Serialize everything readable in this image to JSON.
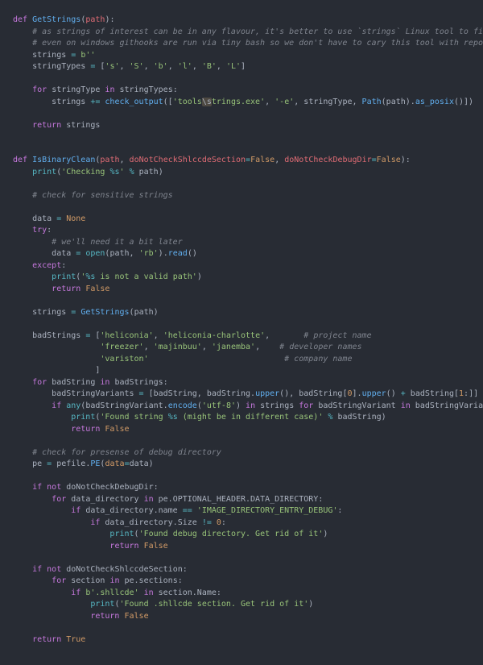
{
  "lines": [
    [
      [
        "kw",
        "def "
      ],
      [
        "fn",
        "GetStrings"
      ],
      [
        "pn",
        "("
      ],
      [
        "var",
        "path"
      ],
      [
        "pn",
        "):"
      ]
    ],
    [
      [
        "pn",
        "    "
      ],
      [
        "cmt",
        "# as strings of interest can be in any flavour, it's better to use `strings` Linux tool to find them all"
      ]
    ],
    [
      [
        "pn",
        "    "
      ],
      [
        "cmt",
        "# even on windows githooks are run via tiny bash so we don't have to cary this tool with repo"
      ]
    ],
    [
      [
        "pn",
        "    "
      ],
      [
        "id",
        "strings "
      ],
      [
        "op",
        "= "
      ],
      [
        "str",
        "b''"
      ]
    ],
    [
      [
        "pn",
        "    "
      ],
      [
        "id",
        "stringTypes "
      ],
      [
        "op",
        "= "
      ],
      [
        "pn",
        "["
      ],
      [
        "str",
        "'s'"
      ],
      [
        "pn",
        ", "
      ],
      [
        "str",
        "'S'"
      ],
      [
        "pn",
        ", "
      ],
      [
        "str",
        "'b'"
      ],
      [
        "pn",
        ", "
      ],
      [
        "str",
        "'l'"
      ],
      [
        "pn",
        ", "
      ],
      [
        "str",
        "'B'"
      ],
      [
        "pn",
        ", "
      ],
      [
        "str",
        "'L'"
      ],
      [
        "pn",
        "]"
      ]
    ],
    [
      [
        "pn",
        " "
      ]
    ],
    [
      [
        "pn",
        "    "
      ],
      [
        "kw",
        "for "
      ],
      [
        "id",
        "stringType "
      ],
      [
        "kw",
        "in "
      ],
      [
        "id",
        "stringTypes:"
      ]
    ],
    [
      [
        "pn",
        "        "
      ],
      [
        "id",
        "strings "
      ],
      [
        "op",
        "+= "
      ],
      [
        "fn",
        "check_output"
      ],
      [
        "pn",
        "(["
      ],
      [
        "str",
        "'tools"
      ],
      [
        "hl",
        "\\s"
      ],
      [
        "str",
        "trings.exe'"
      ],
      [
        "pn",
        ", "
      ],
      [
        "str",
        "'-e'"
      ],
      [
        "pn",
        ", "
      ],
      [
        "id",
        "stringType, "
      ],
      [
        "fn",
        "Path"
      ],
      [
        "pn",
        "("
      ],
      [
        "id",
        "path"
      ],
      [
        "pn",
        ")."
      ],
      [
        "fn",
        "as_posix"
      ],
      [
        "pn",
        "()])"
      ]
    ],
    [
      [
        "pn",
        " "
      ]
    ],
    [
      [
        "pn",
        "    "
      ],
      [
        "kw",
        "return "
      ],
      [
        "id",
        "strings"
      ]
    ],
    [
      [
        "pn",
        " "
      ]
    ],
    [
      [
        "pn",
        " "
      ]
    ],
    [
      [
        "kw",
        "def "
      ],
      [
        "fn",
        "IsBinaryClean"
      ],
      [
        "pn",
        "("
      ],
      [
        "var",
        "path"
      ],
      [
        "pn",
        ", "
      ],
      [
        "var",
        "doNotCheckShlccdeSection"
      ],
      [
        "op",
        "="
      ],
      [
        "cst",
        "False"
      ],
      [
        "pn",
        ", "
      ],
      [
        "var",
        "doNotCheckDebugDir"
      ],
      [
        "op",
        "="
      ],
      [
        "cst",
        "False"
      ],
      [
        "pn",
        "):"
      ]
    ],
    [
      [
        "pn",
        "    "
      ],
      [
        "sp",
        "print"
      ],
      [
        "pn",
        "("
      ],
      [
        "str",
        "'Checking "
      ],
      [
        "esc",
        "%s"
      ],
      [
        "str",
        "'"
      ],
      [
        "pn",
        " "
      ],
      [
        "op",
        "%"
      ],
      [
        "pn",
        " "
      ],
      [
        "id",
        "path)"
      ]
    ],
    [
      [
        "pn",
        " "
      ]
    ],
    [
      [
        "pn",
        "    "
      ],
      [
        "cmt",
        "# check for sensitive strings"
      ]
    ],
    [
      [
        "pn",
        " "
      ]
    ],
    [
      [
        "pn",
        "    "
      ],
      [
        "id",
        "data "
      ],
      [
        "op",
        "= "
      ],
      [
        "cst",
        "None"
      ]
    ],
    [
      [
        "pn",
        "    "
      ],
      [
        "kw",
        "try"
      ],
      [
        "pn",
        ":"
      ]
    ],
    [
      [
        "pn",
        "        "
      ],
      [
        "cmt",
        "# we'll need it a bit later"
      ]
    ],
    [
      [
        "pn",
        "        "
      ],
      [
        "id",
        "data "
      ],
      [
        "op",
        "= "
      ],
      [
        "sp",
        "open"
      ],
      [
        "pn",
        "("
      ],
      [
        "id",
        "path, "
      ],
      [
        "str",
        "'rb'"
      ],
      [
        "pn",
        ")."
      ],
      [
        "fn",
        "read"
      ],
      [
        "pn",
        "()"
      ]
    ],
    [
      [
        "pn",
        "    "
      ],
      [
        "kw",
        "except"
      ],
      [
        "pn",
        ":"
      ]
    ],
    [
      [
        "pn",
        "        "
      ],
      [
        "sp",
        "print"
      ],
      [
        "pn",
        "("
      ],
      [
        "str",
        "'"
      ],
      [
        "esc",
        "%s"
      ],
      [
        "str",
        " is not a valid path'"
      ],
      [
        "pn",
        ")"
      ]
    ],
    [
      [
        "pn",
        "        "
      ],
      [
        "kw",
        "return "
      ],
      [
        "cst",
        "False"
      ]
    ],
    [
      [
        "pn",
        " "
      ]
    ],
    [
      [
        "pn",
        "    "
      ],
      [
        "id",
        "strings "
      ],
      [
        "op",
        "= "
      ],
      [
        "fn",
        "GetStrings"
      ],
      [
        "pn",
        "("
      ],
      [
        "id",
        "path"
      ],
      [
        "pn",
        ")"
      ]
    ],
    [
      [
        "pn",
        " "
      ]
    ],
    [
      [
        "pn",
        "    "
      ],
      [
        "id",
        "badStrings "
      ],
      [
        "op",
        "= "
      ],
      [
        "pn",
        "["
      ],
      [
        "str",
        "'heliconia'"
      ],
      [
        "pn",
        ", "
      ],
      [
        "str",
        "'heliconia-charlotte'"
      ],
      [
        "pn",
        ",       "
      ],
      [
        "cmt",
        "# project name"
      ]
    ],
    [
      [
        "pn",
        "                  "
      ],
      [
        "str",
        "'freezer'"
      ],
      [
        "pn",
        ", "
      ],
      [
        "str",
        "'majinbuu'"
      ],
      [
        "pn",
        ", "
      ],
      [
        "str",
        "'janemba'"
      ],
      [
        "pn",
        ",    "
      ],
      [
        "cmt",
        "# developer names"
      ]
    ],
    [
      [
        "pn",
        "                  "
      ],
      [
        "str",
        "'variston'"
      ],
      [
        "pn",
        "                            "
      ],
      [
        "cmt",
        "# company name"
      ]
    ],
    [
      [
        "pn",
        "                 ]"
      ]
    ],
    [
      [
        "pn",
        "    "
      ],
      [
        "kw",
        "for "
      ],
      [
        "id",
        "badString "
      ],
      [
        "kw",
        "in "
      ],
      [
        "id",
        "badStrings:"
      ]
    ],
    [
      [
        "pn",
        "        "
      ],
      [
        "id",
        "badStringVariants "
      ],
      [
        "op",
        "= "
      ],
      [
        "pn",
        "["
      ],
      [
        "id",
        "badString, badString."
      ],
      [
        "fn",
        "upper"
      ],
      [
        "pn",
        "(), "
      ],
      [
        "id",
        "badString["
      ],
      [
        "num",
        "0"
      ],
      [
        "pn",
        "]."
      ],
      [
        "fn",
        "upper"
      ],
      [
        "pn",
        "() "
      ],
      [
        "op",
        "+"
      ],
      [
        "pn",
        " "
      ],
      [
        "id",
        "badString["
      ],
      [
        "num",
        "1"
      ],
      [
        "pn",
        ":]]"
      ]
    ],
    [
      [
        "pn",
        "        "
      ],
      [
        "kw",
        "if "
      ],
      [
        "sp",
        "any"
      ],
      [
        "pn",
        "("
      ],
      [
        "id",
        "badStringVariant."
      ],
      [
        "fn",
        "encode"
      ],
      [
        "pn",
        "("
      ],
      [
        "str",
        "'utf-8'"
      ],
      [
        "pn",
        ") "
      ],
      [
        "kw",
        "in "
      ],
      [
        "id",
        "strings "
      ],
      [
        "kw",
        "for "
      ],
      [
        "id",
        "badStringVariant "
      ],
      [
        "kw",
        "in "
      ],
      [
        "id",
        "badStringVariants):"
      ]
    ],
    [
      [
        "pn",
        "            "
      ],
      [
        "sp",
        "print"
      ],
      [
        "pn",
        "("
      ],
      [
        "str",
        "'Found string "
      ],
      [
        "esc",
        "%s"
      ],
      [
        "str",
        " (might be in different case)'"
      ],
      [
        "pn",
        " "
      ],
      [
        "op",
        "%"
      ],
      [
        "pn",
        " "
      ],
      [
        "id",
        "badString)"
      ]
    ],
    [
      [
        "pn",
        "            "
      ],
      [
        "kw",
        "return "
      ],
      [
        "cst",
        "False"
      ]
    ],
    [
      [
        "pn",
        " "
      ]
    ],
    [
      [
        "pn",
        "    "
      ],
      [
        "cmt",
        "# check for presense of debug directory"
      ]
    ],
    [
      [
        "pn",
        "    "
      ],
      [
        "id",
        "pe "
      ],
      [
        "op",
        "= "
      ],
      [
        "id",
        "pefile."
      ],
      [
        "fn",
        "PE"
      ],
      [
        "pn",
        "("
      ],
      [
        "kwp",
        "data"
      ],
      [
        "op",
        "="
      ],
      [
        "id",
        "data"
      ],
      [
        "pn",
        ")"
      ]
    ],
    [
      [
        "pn",
        " "
      ]
    ],
    [
      [
        "pn",
        "    "
      ],
      [
        "kw",
        "if "
      ],
      [
        "kw",
        "not "
      ],
      [
        "id",
        "doNotCheckDebugDir:"
      ]
    ],
    [
      [
        "pn",
        "        "
      ],
      [
        "kw",
        "for "
      ],
      [
        "id",
        "data_directory "
      ],
      [
        "kw",
        "in "
      ],
      [
        "id",
        "pe.OPTIONAL_HEADER.DATA_DIRECTORY:"
      ]
    ],
    [
      [
        "pn",
        "            "
      ],
      [
        "kw",
        "if "
      ],
      [
        "id",
        "data_directory.name "
      ],
      [
        "op",
        "== "
      ],
      [
        "str",
        "'IMAGE_DIRECTORY_ENTRY_DEBUG'"
      ],
      [
        "pn",
        ":"
      ]
    ],
    [
      [
        "pn",
        "                "
      ],
      [
        "kw",
        "if "
      ],
      [
        "id",
        "data_directory.Size "
      ],
      [
        "op",
        "!= "
      ],
      [
        "num",
        "0"
      ],
      [
        "pn",
        ":"
      ]
    ],
    [
      [
        "pn",
        "                    "
      ],
      [
        "sp",
        "print"
      ],
      [
        "pn",
        "("
      ],
      [
        "str",
        "'Found debug directory. Get rid of it'"
      ],
      [
        "pn",
        ")"
      ]
    ],
    [
      [
        "pn",
        "                    "
      ],
      [
        "kw",
        "return "
      ],
      [
        "cst",
        "False"
      ]
    ],
    [
      [
        "pn",
        " "
      ]
    ],
    [
      [
        "pn",
        "    "
      ],
      [
        "kw",
        "if "
      ],
      [
        "kw",
        "not "
      ],
      [
        "id",
        "doNotCheckShlccdeSection:"
      ]
    ],
    [
      [
        "pn",
        "        "
      ],
      [
        "kw",
        "for "
      ],
      [
        "id",
        "section "
      ],
      [
        "kw",
        "in "
      ],
      [
        "id",
        "pe.sections:"
      ]
    ],
    [
      [
        "pn",
        "            "
      ],
      [
        "kw",
        "if "
      ],
      [
        "str",
        "b'.shllcde'"
      ],
      [
        "pn",
        " "
      ],
      [
        "kw",
        "in "
      ],
      [
        "id",
        "section.Name:"
      ]
    ],
    [
      [
        "pn",
        "                "
      ],
      [
        "sp",
        "print"
      ],
      [
        "pn",
        "("
      ],
      [
        "str",
        "'Found .shllcde section. Get rid of it'"
      ],
      [
        "pn",
        ")"
      ]
    ],
    [
      [
        "pn",
        "                "
      ],
      [
        "kw",
        "return "
      ],
      [
        "cst",
        "False"
      ]
    ],
    [
      [
        "pn",
        " "
      ]
    ],
    [
      [
        "pn",
        "    "
      ],
      [
        "kw",
        "return "
      ],
      [
        "cst",
        "True"
      ]
    ]
  ]
}
